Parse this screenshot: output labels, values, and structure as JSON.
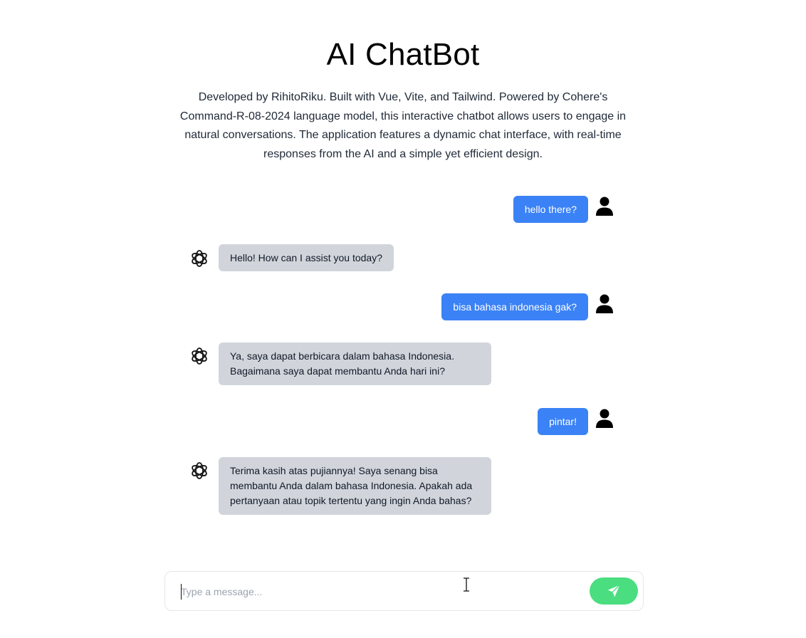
{
  "header": {
    "title": "AI ChatBot",
    "description": "Developed by RihitoRiku. Built with Vue, Vite, and Tailwind. Powered by Cohere's Command-R-08-2024 language model, this interactive chatbot allows users to engage in natural conversations. The application features a dynamic chat interface, with real-time responses from the AI and a simple yet efficient design."
  },
  "messages": [
    {
      "role": "user",
      "text": "hello there?"
    },
    {
      "role": "bot",
      "text": "Hello! How can I assist you today?"
    },
    {
      "role": "user",
      "text": "bisa bahasa indonesia gak?"
    },
    {
      "role": "bot",
      "text": "Ya, saya dapat berbicara dalam bahasa Indonesia. Bagaimana saya dapat membantu Anda hari ini?"
    },
    {
      "role": "user",
      "text": "pintar!"
    },
    {
      "role": "bot",
      "text": "Terima kasih atas pujiannya! Saya senang bisa membantu Anda dalam bahasa Indonesia. Apakah ada pertanyaan atau topik tertentu yang ingin Anda bahas?"
    }
  ],
  "input": {
    "placeholder": "Type a message...",
    "value": ""
  },
  "icons": {
    "user": "user-avatar-icon",
    "bot": "openai-logo-icon",
    "send": "send-paper-plane-icon"
  },
  "colors": {
    "user_bubble": "#3b82f6",
    "bot_bubble": "#d1d5db",
    "send_button": "#4ade80"
  }
}
